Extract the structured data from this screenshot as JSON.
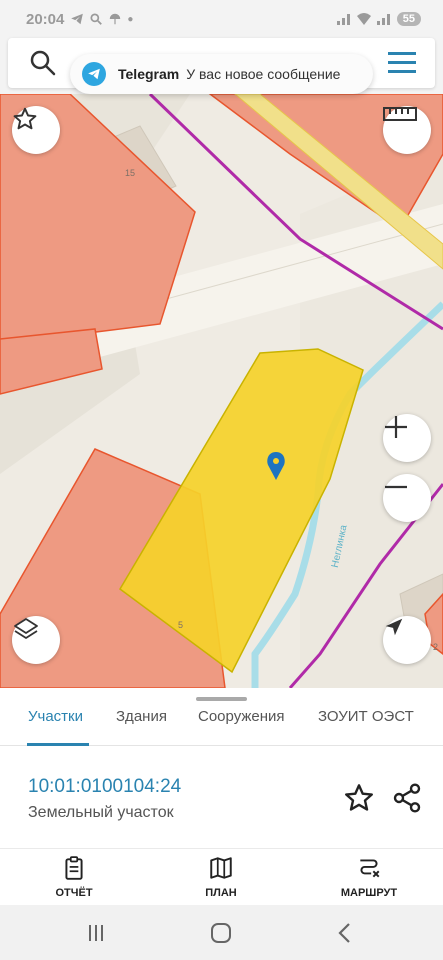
{
  "status_bar": {
    "time": "20:04",
    "battery": "55",
    "icons": [
      "telegram-icon",
      "search-icon",
      "weather-icon",
      "dot-icon",
      "signal-icon",
      "wifi-icon",
      "battery-icon"
    ]
  },
  "search": {
    "icons": [
      "search-icon",
      "menu-icon"
    ]
  },
  "notification": {
    "app": "Telegram",
    "message": "У вас новое сообщение"
  },
  "map": {
    "labels": {
      "building_15": "15",
      "building_5": "5",
      "building_2": "2",
      "stream": "Неглинка"
    },
    "colors": {
      "parcel_selected": "#f5d12a",
      "parcel_other": "#ee9a82",
      "boundary_purple": "#b02aa8",
      "boundary_orange": "#e8562e",
      "stream": "#a8dde8"
    },
    "buttons": [
      "favorites-star-icon",
      "ruler-icon",
      "zoom-in-icon",
      "zoom-out-icon",
      "layers-icon",
      "location-arrow-icon"
    ]
  },
  "tabs": [
    {
      "label": "Участки",
      "active": true
    },
    {
      "label": "Здания",
      "active": false
    },
    {
      "label": "Сооружения",
      "active": false
    },
    {
      "label": "ЗОУИТ ОЭСТ",
      "active": false
    }
  ],
  "parcel": {
    "cadastral_number": "10:01:0100104:24",
    "type": "Земельный участок"
  },
  "actions": [
    {
      "label": "ОТЧЁТ",
      "icon": "report-icon"
    },
    {
      "label": "ПЛАН",
      "icon": "map-plan-icon"
    },
    {
      "label": "МАРШРУТ",
      "icon": "route-icon"
    }
  ],
  "colors": {
    "accent": "#2a83b0"
  }
}
